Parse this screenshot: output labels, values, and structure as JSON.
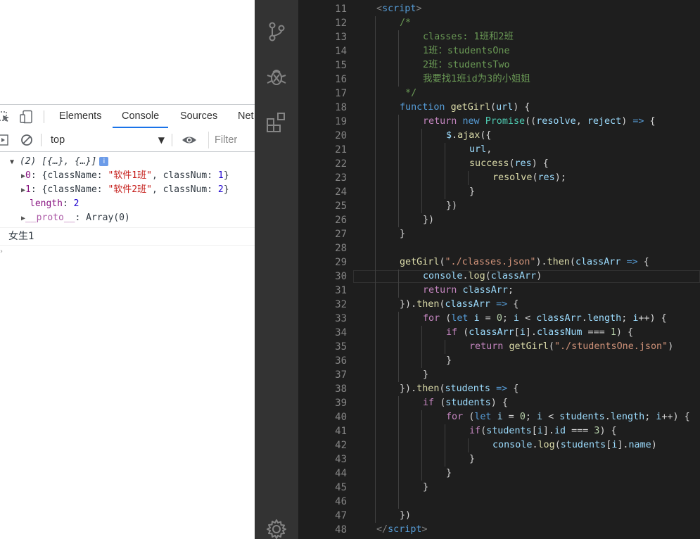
{
  "devtools": {
    "tabs": [
      "Elements",
      "Console",
      "Sources",
      "Net"
    ],
    "active_tab": "Console",
    "context_select": "top",
    "filter_placeholder": "Filter",
    "log": {
      "array_summary": "(2) [{…}, {…}]",
      "info_badge": "i",
      "item0": {
        "index": "0",
        "key1": "className",
        "val1": "\"软件1班\"",
        "key2": "classNum",
        "val2": "1"
      },
      "item1": {
        "index": "1",
        "key1": "className",
        "val1": "\"软件2班\"",
        "key2": "classNum",
        "val2": "2"
      },
      "length_key": "length",
      "length_val": "2",
      "proto_key": "__proto__",
      "proto_val": "Array(0)",
      "second_output": "女生1"
    }
  },
  "editor": {
    "first_line_number": 11,
    "line_count": 38,
    "current_line": 30,
    "theme_colors": {
      "background": "#1e1e1e",
      "activity_bar": "#333333",
      "keyword": "#569cd6",
      "control": "#c586c0",
      "function": "#dcdcaa",
      "variable": "#9cdcfe",
      "string": "#ce9178",
      "comment": "#6a9955",
      "number": "#b5cea8",
      "class": "#4ec9b0"
    },
    "activity_icons": [
      "source-control-icon",
      "debug-icon",
      "extensions-icon",
      "settings-gear-icon"
    ],
    "lines": [
      [
        [
          "t-punc",
          "<"
        ],
        [
          "t-tag",
          "script"
        ],
        [
          "t-punc",
          ">"
        ]
      ],
      [
        [
          "t-com",
          "/*"
        ]
      ],
      [
        [
          "t-com",
          "classes: 1班和2班"
        ]
      ],
      [
        [
          "t-com",
          "1班：studentsOne"
        ]
      ],
      [
        [
          "t-com",
          "2班：studentsTwo"
        ]
      ],
      [
        [
          "t-com",
          "我要找1班id为3的小姐姐"
        ]
      ],
      [
        [
          "t-com",
          " */"
        ]
      ],
      [
        [
          "t-kw",
          "function "
        ],
        [
          "t-fn",
          "getGirl"
        ],
        [
          "t-txt",
          "("
        ],
        [
          "t-var",
          "url"
        ],
        [
          "t-txt",
          ") {"
        ]
      ],
      [
        [
          "t-ctl",
          "return "
        ],
        [
          "t-kw",
          "new "
        ],
        [
          "t-cls",
          "Promise"
        ],
        [
          "t-txt",
          "(("
        ],
        [
          "t-var",
          "resolve"
        ],
        [
          "t-txt",
          ", "
        ],
        [
          "t-var",
          "reject"
        ],
        [
          "t-txt",
          ") "
        ],
        [
          "t-kw",
          "=>"
        ],
        [
          "t-txt",
          " {"
        ]
      ],
      [
        [
          "t-var",
          "$"
        ],
        [
          "t-txt",
          "."
        ],
        [
          "t-fn",
          "ajax"
        ],
        [
          "t-txt",
          "({"
        ]
      ],
      [
        [
          "t-var",
          "url"
        ],
        [
          "t-txt",
          ","
        ]
      ],
      [
        [
          "t-fn",
          "success"
        ],
        [
          "t-txt",
          "("
        ],
        [
          "t-var",
          "res"
        ],
        [
          "t-txt",
          ") {"
        ]
      ],
      [
        [
          "t-fn",
          "resolve"
        ],
        [
          "t-txt",
          "("
        ],
        [
          "t-var",
          "res"
        ],
        [
          "t-txt",
          ");"
        ]
      ],
      [
        [
          "t-txt",
          "}"
        ]
      ],
      [
        [
          "t-txt",
          "})"
        ]
      ],
      [
        [
          "t-txt",
          "})"
        ]
      ],
      [
        [
          "t-txt",
          "}"
        ]
      ],
      [],
      [
        [
          "t-fn",
          "getGirl"
        ],
        [
          "t-txt",
          "("
        ],
        [
          "t-str",
          "\"./classes.json\""
        ],
        [
          "t-txt",
          ")."
        ],
        [
          "t-fn",
          "then"
        ],
        [
          "t-txt",
          "("
        ],
        [
          "t-var",
          "classArr"
        ],
        [
          "t-txt",
          " "
        ],
        [
          "t-kw",
          "=>"
        ],
        [
          "t-txt",
          " {"
        ]
      ],
      [
        [
          "t-var",
          "console"
        ],
        [
          "t-txt",
          "."
        ],
        [
          "t-fn",
          "log"
        ],
        [
          "t-txt",
          "("
        ],
        [
          "t-var",
          "classArr"
        ],
        [
          "t-txt",
          ")"
        ]
      ],
      [
        [
          "t-ctl",
          "return "
        ],
        [
          "t-var",
          "classArr"
        ],
        [
          "t-txt",
          ";"
        ]
      ],
      [
        [
          "t-txt",
          "})."
        ],
        [
          "t-fn",
          "then"
        ],
        [
          "t-txt",
          "("
        ],
        [
          "t-var",
          "classArr"
        ],
        [
          "t-txt",
          " "
        ],
        [
          "t-kw",
          "=>"
        ],
        [
          "t-txt",
          " {"
        ]
      ],
      [
        [
          "t-ctl",
          "for "
        ],
        [
          "t-txt",
          "("
        ],
        [
          "t-kw",
          "let "
        ],
        [
          "t-var",
          "i"
        ],
        [
          "t-txt",
          " = "
        ],
        [
          "t-num",
          "0"
        ],
        [
          "t-txt",
          "; "
        ],
        [
          "t-var",
          "i"
        ],
        [
          "t-txt",
          " < "
        ],
        [
          "t-var",
          "classArr"
        ],
        [
          "t-txt",
          "."
        ],
        [
          "t-var",
          "length"
        ],
        [
          "t-txt",
          "; "
        ],
        [
          "t-var",
          "i"
        ],
        [
          "t-txt",
          "++) {"
        ]
      ],
      [
        [
          "t-ctl",
          "if "
        ],
        [
          "t-txt",
          "("
        ],
        [
          "t-var",
          "classArr"
        ],
        [
          "t-txt",
          "["
        ],
        [
          "t-var",
          "i"
        ],
        [
          "t-txt",
          "]."
        ],
        [
          "t-var",
          "classNum"
        ],
        [
          "t-txt",
          " === "
        ],
        [
          "t-num",
          "1"
        ],
        [
          "t-txt",
          ") {"
        ]
      ],
      [
        [
          "t-ctl",
          "return "
        ],
        [
          "t-fn",
          "getGirl"
        ],
        [
          "t-txt",
          "("
        ],
        [
          "t-str",
          "\"./studentsOne.json\""
        ],
        [
          "t-txt",
          ")"
        ]
      ],
      [
        [
          "t-txt",
          "}"
        ]
      ],
      [
        [
          "t-txt",
          "}"
        ]
      ],
      [
        [
          "t-txt",
          "})."
        ],
        [
          "t-fn",
          "then"
        ],
        [
          "t-txt",
          "("
        ],
        [
          "t-var",
          "students"
        ],
        [
          "t-txt",
          " "
        ],
        [
          "t-kw",
          "=>"
        ],
        [
          "t-txt",
          " {"
        ]
      ],
      [
        [
          "t-ctl",
          "if "
        ],
        [
          "t-txt",
          "("
        ],
        [
          "t-var",
          "students"
        ],
        [
          "t-txt",
          ") {"
        ]
      ],
      [
        [
          "t-ctl",
          "for "
        ],
        [
          "t-txt",
          "("
        ],
        [
          "t-kw",
          "let "
        ],
        [
          "t-var",
          "i"
        ],
        [
          "t-txt",
          " = "
        ],
        [
          "t-num",
          "0"
        ],
        [
          "t-txt",
          "; "
        ],
        [
          "t-var",
          "i"
        ],
        [
          "t-txt",
          " < "
        ],
        [
          "t-var",
          "students"
        ],
        [
          "t-txt",
          "."
        ],
        [
          "t-var",
          "length"
        ],
        [
          "t-txt",
          "; "
        ],
        [
          "t-var",
          "i"
        ],
        [
          "t-txt",
          "++) {"
        ]
      ],
      [
        [
          "t-ctl",
          "if"
        ],
        [
          "t-txt",
          "("
        ],
        [
          "t-var",
          "students"
        ],
        [
          "t-txt",
          "["
        ],
        [
          "t-var",
          "i"
        ],
        [
          "t-txt",
          "]."
        ],
        [
          "t-var",
          "id"
        ],
        [
          "t-txt",
          " === "
        ],
        [
          "t-num",
          "3"
        ],
        [
          "t-txt",
          ") {"
        ]
      ],
      [
        [
          "t-var",
          "console"
        ],
        [
          "t-txt",
          "."
        ],
        [
          "t-fn",
          "log"
        ],
        [
          "t-txt",
          "("
        ],
        [
          "t-var",
          "students"
        ],
        [
          "t-txt",
          "["
        ],
        [
          "t-var",
          "i"
        ],
        [
          "t-txt",
          "]."
        ],
        [
          "t-var",
          "name"
        ],
        [
          "t-txt",
          ")"
        ]
      ],
      [
        [
          "t-txt",
          "}"
        ]
      ],
      [
        [
          "t-txt",
          "}"
        ]
      ],
      [
        [
          "t-txt",
          "}"
        ]
      ],
      [],
      [
        [
          "t-txt",
          "})"
        ]
      ],
      [
        [
          "t-punc",
          "</"
        ],
        [
          "t-tag",
          "script"
        ],
        [
          "t-punc",
          ">"
        ]
      ]
    ],
    "indents": [
      1,
      2,
      3,
      3,
      3,
      3,
      2,
      2,
      3,
      4,
      5,
      5,
      6,
      5,
      4,
      3,
      2,
      0,
      2,
      3,
      3,
      2,
      3,
      4,
      5,
      4,
      3,
      2,
      3,
      4,
      5,
      6,
      5,
      4,
      3,
      0,
      2,
      1
    ]
  }
}
